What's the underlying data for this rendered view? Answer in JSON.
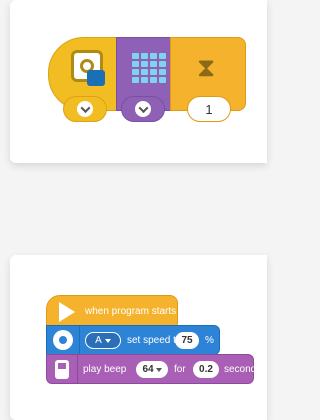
{
  "icon_row": {
    "blocks": [
      {
        "icon": "distance-sensor-icon",
        "color": "#f2bd22"
      },
      {
        "icon": "light-matrix-icon",
        "color": "#8e61b6"
      },
      {
        "icon": "hourglass-icon",
        "color": "#f5b32d"
      }
    ],
    "wait_value": "1"
  },
  "program": {
    "start_label": "when program starts",
    "motor": {
      "port": "A",
      "label": "set speed to",
      "speed": "75",
      "unit": "%"
    },
    "beep": {
      "label": "play beep",
      "note": "64",
      "for_label": "for",
      "duration": "0.2",
      "unit": "seconds"
    }
  },
  "colors": {
    "events": "#f5b32d",
    "motors": "#2d83d6",
    "sound": "#a85fb5",
    "light": "#8e61b6",
    "sensors": "#f2bd22"
  }
}
